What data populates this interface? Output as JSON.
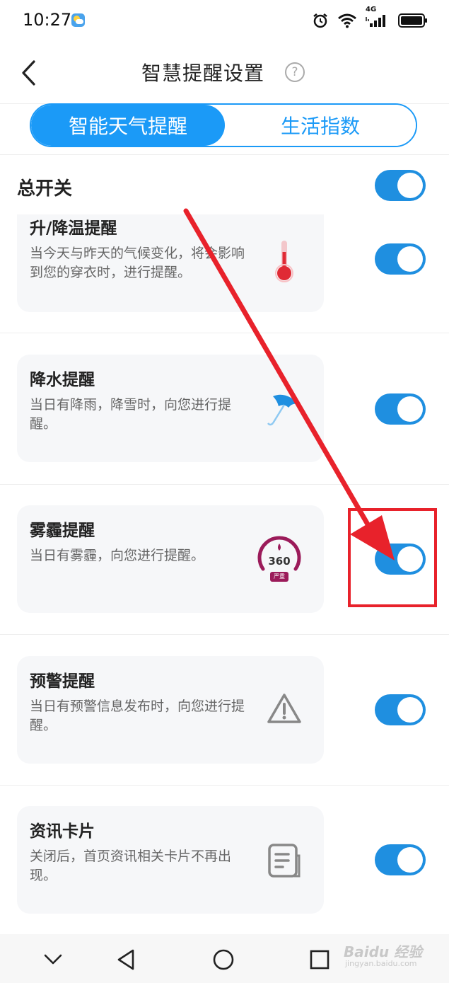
{
  "status_bar": {
    "time": "10:27",
    "network": "4G"
  },
  "header": {
    "title": "智慧提醒设置",
    "help_symbol": "?"
  },
  "tabs": [
    {
      "label": "智能天气提醒",
      "active": true
    },
    {
      "label": "生活指数",
      "active": false
    }
  ],
  "master_switch": {
    "label": "总开关",
    "on": true
  },
  "reminders": [
    {
      "title": "升/降温提醒",
      "desc": "当今天与昨天的气候变化，将会影响到您的穿衣时，进行提醒。",
      "icon": "thermometer-icon",
      "on": true
    },
    {
      "title": "降水提醒",
      "desc": "当日有降雨，降雪时，向您进行提醒。",
      "icon": "umbrella-icon",
      "on": true
    },
    {
      "title": "雾霾提醒",
      "desc": "当日有雾霾，向您进行提醒。",
      "icon": "air-quality-gauge-icon",
      "gauge_value": "360",
      "gauge_label": "严重",
      "on": true
    },
    {
      "title": "预警提醒",
      "desc": "当日有预警信息发布时，向您进行提醒。",
      "icon": "warning-triangle-icon",
      "on": true
    },
    {
      "title": "资讯卡片",
      "desc": "关闭后，首页资讯相关卡片不再出现。",
      "icon": "news-card-icon",
      "on": true
    }
  ],
  "watermark": {
    "main": "Baidu 经验",
    "sub": "jingyan.baidu.com"
  },
  "colors": {
    "accent": "#1b9af7",
    "toggle_on": "#1f8fe0",
    "annotation": "#e8222b"
  }
}
